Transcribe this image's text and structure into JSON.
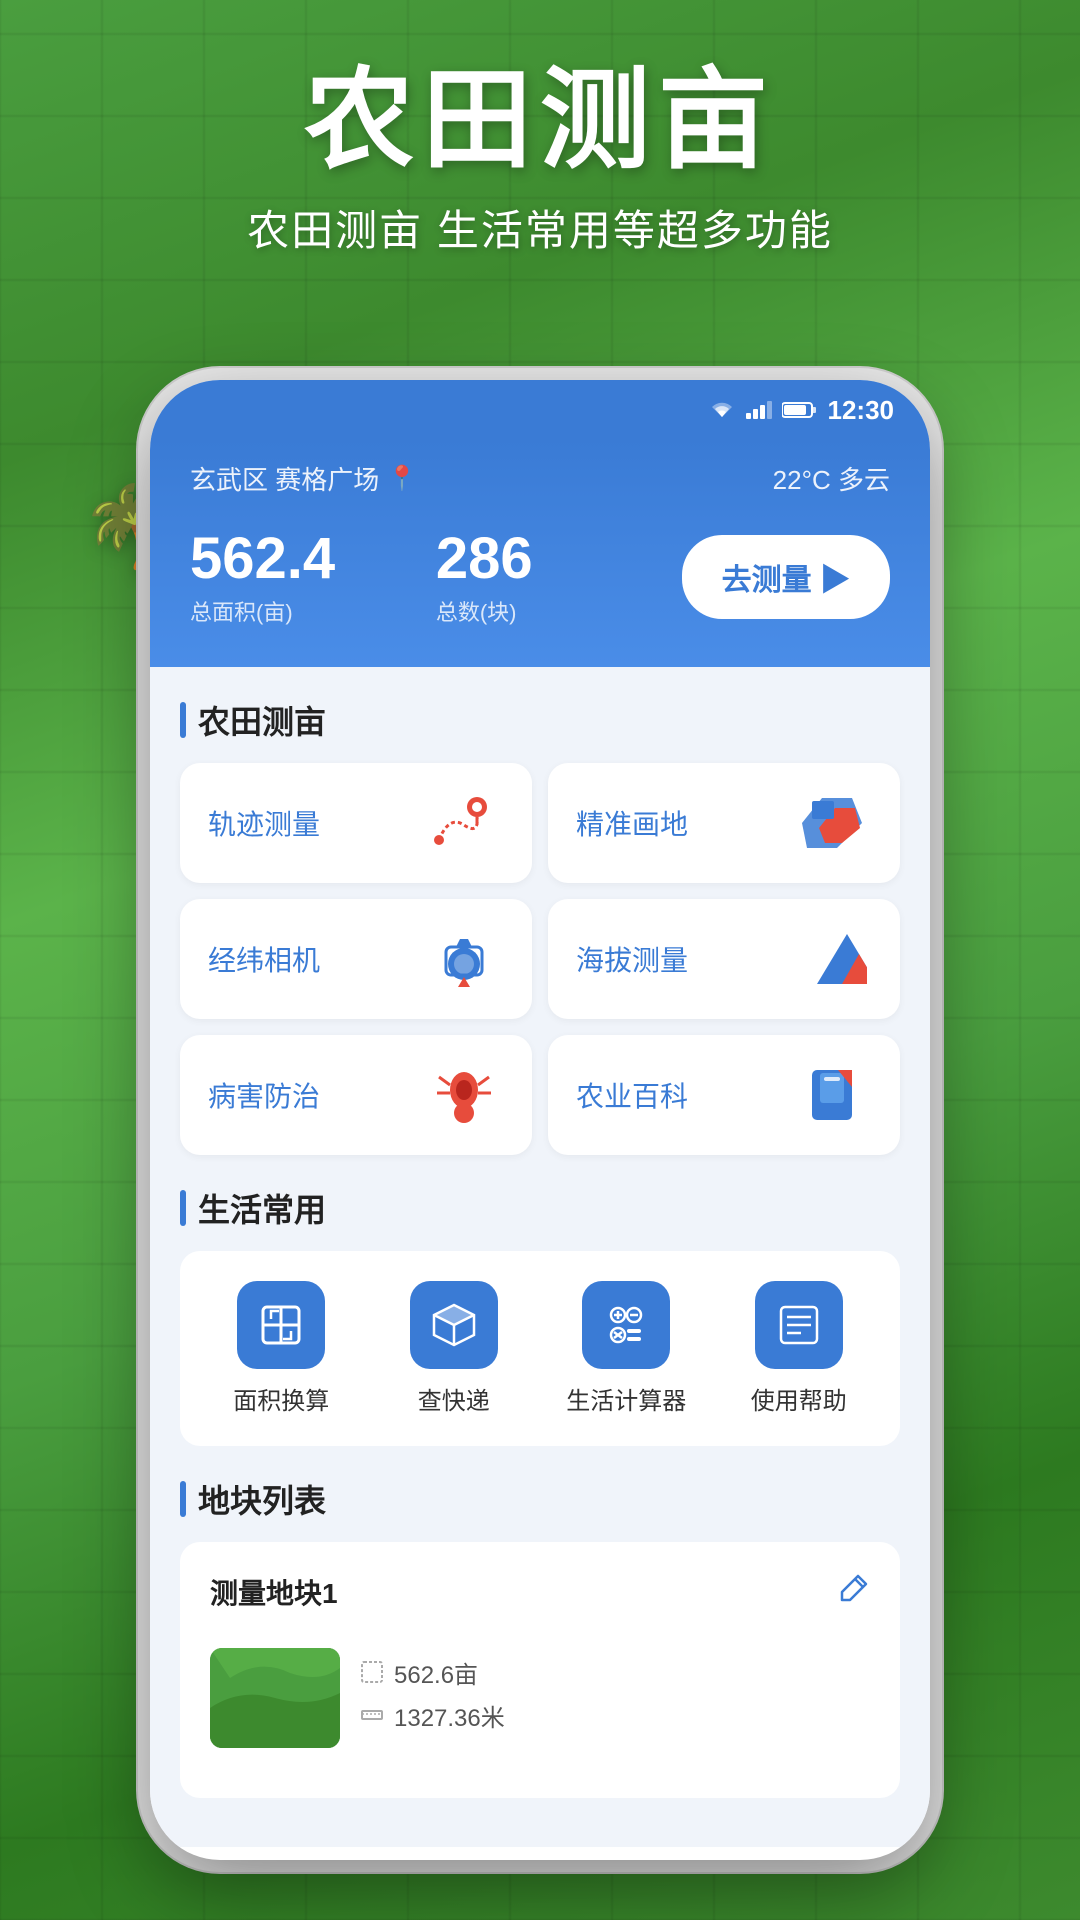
{
  "background": {
    "color": "#4a9e3f"
  },
  "hero": {
    "title": "农田测亩",
    "subtitle": "农田测亩 生活常用等超多功能"
  },
  "status_bar": {
    "time": "12:30",
    "battery_icon": "🔋",
    "signal": "▲"
  },
  "header": {
    "location": "玄武区 赛格广场",
    "weather": "22°C  多云",
    "total_area_value": "562.4",
    "total_area_label": "总面积(亩)",
    "total_count_value": "286",
    "total_count_label": "总数(块)",
    "measure_btn": "去测量 ▶"
  },
  "farming_section": {
    "title": "农田测亩",
    "features": [
      {
        "label": "轨迹测量",
        "icon": "track"
      },
      {
        "label": "精准画地",
        "icon": "draw"
      },
      {
        "label": "经纬相机",
        "icon": "camera"
      },
      {
        "label": "海拔测量",
        "icon": "altitude"
      },
      {
        "label": "病害防治",
        "icon": "pest"
      },
      {
        "label": "农业百科",
        "icon": "encyclopedia"
      }
    ]
  },
  "life_section": {
    "title": "生活常用",
    "items": [
      {
        "label": "面积换算",
        "icon": "📐"
      },
      {
        "label": "查快递",
        "icon": "📦"
      },
      {
        "label": "生活计算器",
        "icon": "🔢"
      },
      {
        "label": "使用帮助",
        "icon": "📋"
      }
    ]
  },
  "land_section": {
    "title": "地块列表",
    "items": [
      {
        "name": "测量地块1",
        "area": "562.6亩",
        "perimeter": "1327.36米"
      }
    ]
  }
}
